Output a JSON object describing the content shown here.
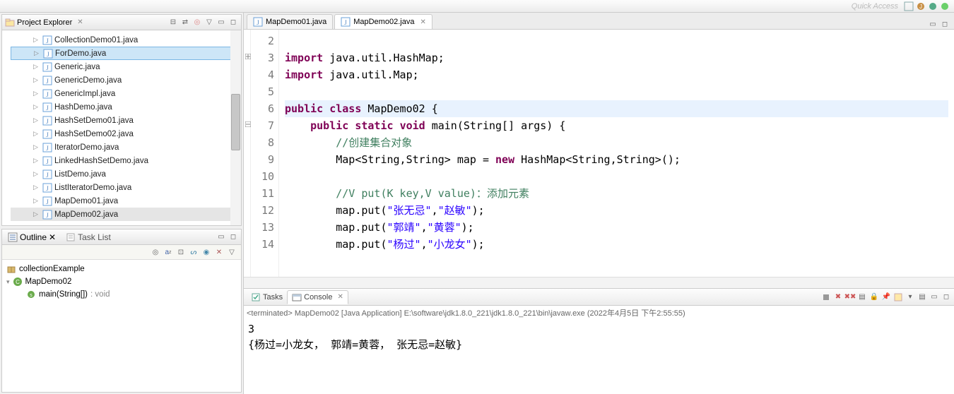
{
  "topbar": {
    "quick_access": "Quick Access"
  },
  "explorer": {
    "title": "Project Explorer",
    "files": [
      {
        "name": "CollectionDemo01.java",
        "sel": false
      },
      {
        "name": "ForDemo.java",
        "sel": true
      },
      {
        "name": "Generic.java",
        "sel": false
      },
      {
        "name": "GenericDemo.java",
        "sel": false
      },
      {
        "name": "GenericImpl.java",
        "sel": false
      },
      {
        "name": "HashDemo.java",
        "sel": false
      },
      {
        "name": "HashSetDemo01.java",
        "sel": false
      },
      {
        "name": "HashSetDemo02.java",
        "sel": false
      },
      {
        "name": "IteratorDemo.java",
        "sel": false
      },
      {
        "name": "LinkedHashSetDemo.java",
        "sel": false
      },
      {
        "name": "ListDemo.java",
        "sel": false
      },
      {
        "name": "ListIteratorDemo.java",
        "sel": false
      },
      {
        "name": "MapDemo01.java",
        "sel": false
      },
      {
        "name": "MapDemo02.java",
        "sel": true
      }
    ]
  },
  "outline": {
    "title": "Outline",
    "tasklist": "Task List",
    "pkg": "collectionExample",
    "cls": "MapDemo02",
    "method": "main(String[])",
    "rettype": ": void"
  },
  "editor": {
    "tabs": [
      {
        "label": "MapDemo01.java",
        "active": false
      },
      {
        "label": "MapDemo02.java",
        "active": true
      }
    ],
    "lines": [
      {
        "n": 2,
        "html": ""
      },
      {
        "n": 3,
        "html": "<span class='kw'>import</span> java.util.HashMap;",
        "marker": "plus"
      },
      {
        "n": 4,
        "html": "<span class='kw'>import</span> java.util.Map;"
      },
      {
        "n": 5,
        "html": ""
      },
      {
        "n": 6,
        "html": "<span class='kw'>public</span> <span class='kw'>class</span> MapDemo02 {",
        "hl": true
      },
      {
        "n": 7,
        "html": "    <span class='kw'>public</span> <span class='kw'>static</span> <span class='kw'>void</span> main(String[] args) {",
        "marker": "minus"
      },
      {
        "n": 8,
        "html": "        <span class='cm'>//创建集合对象</span>"
      },
      {
        "n": 9,
        "html": "        Map&lt;String,String&gt; map = <span class='kw'>new</span> HashMap&lt;String,String&gt;();"
      },
      {
        "n": 10,
        "html": ""
      },
      {
        "n": 11,
        "html": "        <span class='cm'>//V put(K key,V value)：</span><span class='info'>添加元素</span>"
      },
      {
        "n": 12,
        "html": "        map.put(<span class='str'>\"张无忌\"</span>,<span class='str'>\"赵敏\"</span>);"
      },
      {
        "n": 13,
        "html": "        map.put(<span class='str'>\"郭靖\"</span>,<span class='str'>\"黄蓉\"</span>);"
      },
      {
        "n": 14,
        "html": "        map.put(<span class='str'>\"杨过\"</span>,<span class='str'>\"小龙女\"</span>);"
      }
    ]
  },
  "console": {
    "tasks": "Tasks",
    "label": "Console",
    "status": "<terminated> MapDemo02 [Java Application] E:\\software\\jdk1.8.0_221\\jdk1.8.0_221\\bin\\javaw.exe (2022年4月5日 下午2:55:55)",
    "out": [
      "3",
      "{杨过=小龙女， 郭靖=黄蓉， 张无忌=赵敏}"
    ]
  }
}
